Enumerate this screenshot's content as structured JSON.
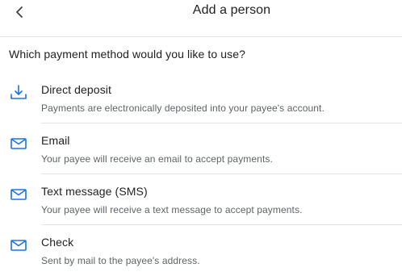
{
  "header": {
    "title": "Add a person",
    "back_icon": "chevron-left-icon"
  },
  "question": "Which payment method would you like to use?",
  "options": [
    {
      "icon": "download-icon",
      "title": "Direct deposit",
      "description": "Payments are electronically deposited into your payee's account."
    },
    {
      "icon": "mail-icon",
      "title": "Email",
      "description": "Your payee will receive an email to accept payments."
    },
    {
      "icon": "mail-icon",
      "title": "Text message (SMS)",
      "description": "Your payee will receive a text message to accept payments."
    },
    {
      "icon": "mail-icon",
      "title": "Check",
      "description": "Sent by mail to the payee's address."
    }
  ],
  "colors": {
    "icon_accent": "#1a73e8",
    "text_primary": "#202124",
    "text_secondary": "#5f6368",
    "divider": "#e3e3e3"
  }
}
